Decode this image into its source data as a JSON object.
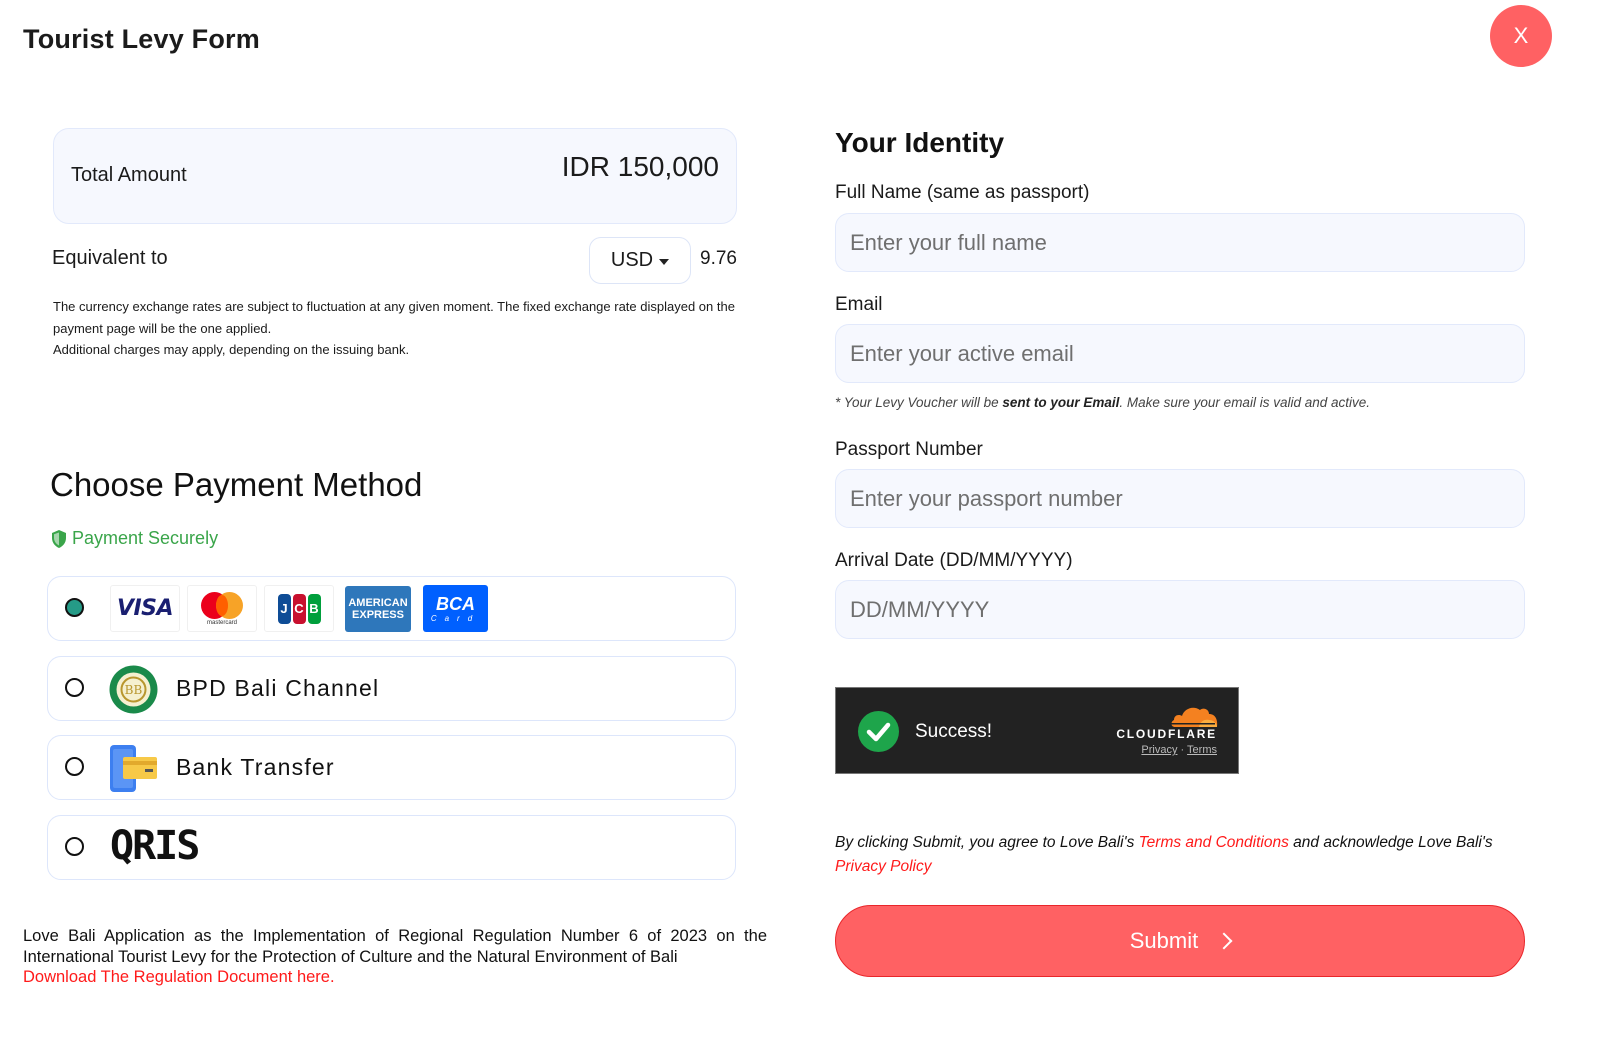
{
  "header": {
    "title": "Tourist Levy Form",
    "close_label": "X"
  },
  "amount": {
    "total_label": "Total Amount",
    "total_value": "IDR 150,000",
    "equivalent_label": "Equivalent to",
    "currency_selected": "USD",
    "equivalent_value": "9.76",
    "disclaimer_line1": "The currency exchange rates are subject to fluctuation at any given moment. The fixed exchange rate displayed on the payment page will be the one applied.",
    "disclaimer_line2": "Additional charges may apply, depending on the issuing bank."
  },
  "payment": {
    "title": "Choose Payment Method",
    "secure_label": "Payment Securely",
    "secure_color": "#3aa54a",
    "selected_index": 0,
    "methods": [
      {
        "id": "card",
        "label": "",
        "logos": [
          {
            "name": "visa",
            "text": "VISA"
          },
          {
            "name": "mastercard",
            "text": "mastercard"
          },
          {
            "name": "jcb",
            "letters": [
              "J",
              "C",
              "B"
            ]
          },
          {
            "name": "american-express",
            "line1": "AMERICAN",
            "line2": "EXPRESS"
          },
          {
            "name": "bca-card",
            "line1": "BCA",
            "line2": "Card"
          }
        ]
      },
      {
        "id": "bpd-bali",
        "label": "BPD Bali Channel",
        "icon": "bpd-bali-logo-icon",
        "icon_text": "BB"
      },
      {
        "id": "bank-transfer",
        "label": "Bank Transfer",
        "icon": "bank-transfer-icon"
      },
      {
        "id": "qris",
        "label": "QRIS",
        "icon": "qris-logo"
      }
    ]
  },
  "regulation": {
    "text": "Love Bali Application as the Implementation of Regional Regulation Number 6 of 2023 on the International Tourist Levy for the Protection of Culture and the Natural Environment of Bali",
    "link": "Download The Regulation Document here."
  },
  "identity": {
    "title": "Your Identity",
    "fields": {
      "full_name": {
        "label": "Full Name (same as passport)",
        "placeholder": "Enter your full name",
        "value": ""
      },
      "email": {
        "label": "Email",
        "placeholder": "Enter your active email",
        "value": ""
      },
      "passport": {
        "label": "Passport Number",
        "placeholder": "Enter your passport number",
        "value": ""
      },
      "arrival": {
        "label": "Arrival Date (DD/MM/YYYY)",
        "placeholder": "DD/MM/YYYY",
        "value": ""
      }
    },
    "email_note_prefix": "* Your Levy Voucher will be ",
    "email_note_bold": "sent to your Email",
    "email_note_suffix": ". Make sure your email is valid and active."
  },
  "captcha": {
    "status": "Success!",
    "brand": "CLOUDFLARE",
    "privacy": "Privacy",
    "separator": "·",
    "terms": "Terms"
  },
  "agreement": {
    "prefix": "By clicking Submit, you agree to Love Bali's ",
    "terms_link": "Terms and Conditions",
    "middle": " and acknowledge Love Bali's ",
    "privacy_link": "Privacy Policy"
  },
  "submit": {
    "label": "Submit"
  },
  "colors": {
    "accent": "#ff6163",
    "link_red": "#ff1a1a",
    "radio_selected": "#259b87",
    "input_bg": "#f6f8fe"
  }
}
